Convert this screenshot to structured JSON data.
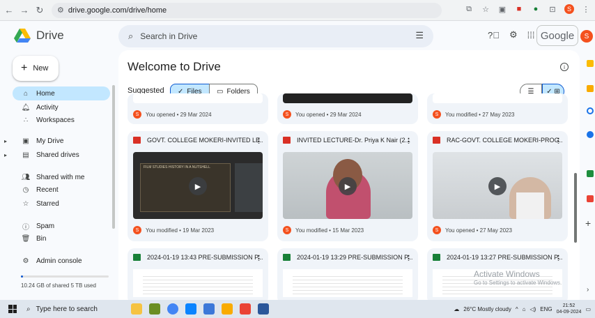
{
  "browser": {
    "url": "drive.google.com/drive/home",
    "profile_initial": "S"
  },
  "header": {
    "app_name": "Drive",
    "search_placeholder": "Search in Drive",
    "wordmark": "Google",
    "account_initial": "S"
  },
  "sidebar": {
    "new_label": "New",
    "items": [
      {
        "label": "Home",
        "icon": "home-icon"
      },
      {
        "label": "Activity",
        "icon": "bell-icon"
      },
      {
        "label": "Workspaces",
        "icon": "workspaces-icon"
      },
      {
        "label": "My Drive",
        "icon": "my-drive-icon"
      },
      {
        "label": "Shared drives",
        "icon": "shared-drives-icon"
      },
      {
        "label": "Shared with me",
        "icon": "people-icon"
      },
      {
        "label": "Recent",
        "icon": "clock-icon"
      },
      {
        "label": "Starred",
        "icon": "star-icon"
      },
      {
        "label": "Spam",
        "icon": "spam-icon"
      },
      {
        "label": "Bin",
        "icon": "trash-icon"
      },
      {
        "label": "Admin console",
        "icon": "admin-icon"
      }
    ],
    "storage_text": "10.24 GB of shared 5 TB used",
    "storage_fraction": 0.002
  },
  "main": {
    "title": "Welcome to Drive",
    "suggested_label": "Suggested",
    "chip_files": "Files",
    "chip_folders": "Folders",
    "row1_meta": [
      "You opened • 29 Mar 2024",
      "You opened • 29 Mar 2024",
      "You modified • 27 May 2023"
    ],
    "video_cards": [
      {
        "title": "GOVT. COLLEGE MOKERI-INVITED LE...",
        "meta": "You modified • 19 Mar 2023",
        "thumb_text": "FILM STUDIES HISTORY IN A NUTSHELL"
      },
      {
        "title": "INVITED LECTURE-Dr. Priya K Nair (2...",
        "meta": "You modified • 15 Mar 2023"
      },
      {
        "title": "RAC-GOVT. COLLEGE MOKERI-PROG...",
        "meta": "You opened • 27 May 2023"
      }
    ],
    "sheet_cards": [
      {
        "title": "2024-01-19 13:43 PRE-SUBMISSION P..."
      },
      {
        "title": "2024-01-19 13:29 PRE-SUBMISSION P..."
      },
      {
        "title": "2024-01-19 13:27 PRE-SUBMISSION P..."
      }
    ]
  },
  "watermark": {
    "title": "Activate Windows",
    "subtitle": "Go to Settings to activate Windows."
  },
  "taskbar": {
    "search_placeholder": "Type here to search",
    "weather": "26°C  Mostly cloudy",
    "language": "ENG",
    "time": "21:52",
    "date": "04-09-2024"
  },
  "colors": {
    "accent": "#0b57d0",
    "selected_bg": "#c2e7ff",
    "avatar": "#f4511e"
  }
}
